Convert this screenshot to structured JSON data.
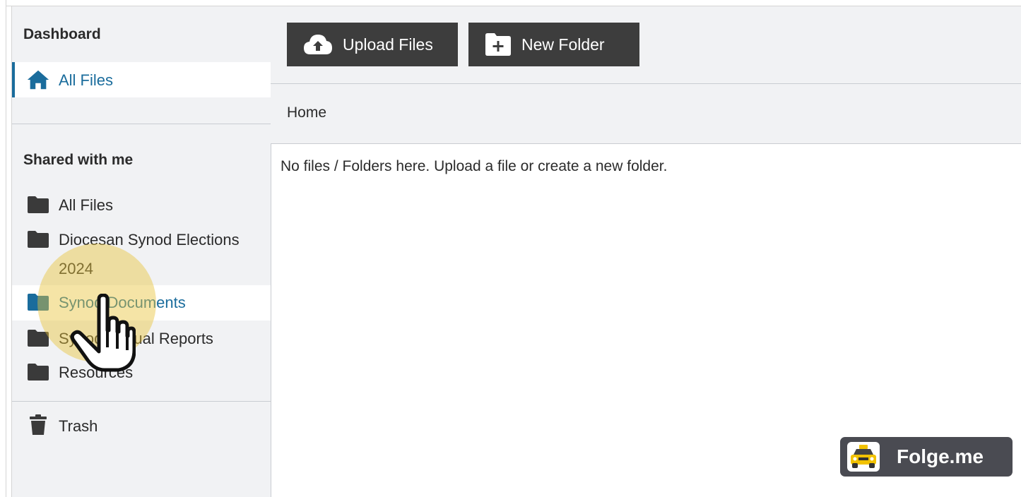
{
  "sidebar": {
    "dashboard_title": "Dashboard",
    "home_item": {
      "label": "All Files",
      "icon": "home-icon"
    },
    "shared_title": "Shared with me",
    "shared_items": [
      {
        "label": "All Files",
        "icon": "folder-icon"
      },
      {
        "label": "Diocesan Synod Elections 2024",
        "icon": "folder-icon"
      },
      {
        "label": "Synod Documents",
        "icon": "folder-icon"
      },
      {
        "label": "Synod Annual Reports",
        "icon": "folder-icon"
      },
      {
        "label": "Resources",
        "icon": "folder-icon"
      }
    ],
    "trash": {
      "label": "Trash",
      "icon": "trash-icon"
    }
  },
  "toolbar": {
    "upload_label": "Upload Files",
    "upload_icon": "cloud-upload-icon",
    "new_folder_label": "New Folder",
    "new_folder_icon": "folder-plus-icon"
  },
  "breadcrumb": {
    "home": "Home"
  },
  "main": {
    "empty_message": "No files / Folders here. Upload a file or create a new folder."
  },
  "badge": {
    "text": "Folge.me"
  },
  "colors": {
    "accent": "#1a6c9c",
    "button_bg": "#3d3d3d",
    "panel_bg": "#f1f2f4",
    "click_highlight": "#e8c43a",
    "badge_bg": "#4a4b52"
  }
}
